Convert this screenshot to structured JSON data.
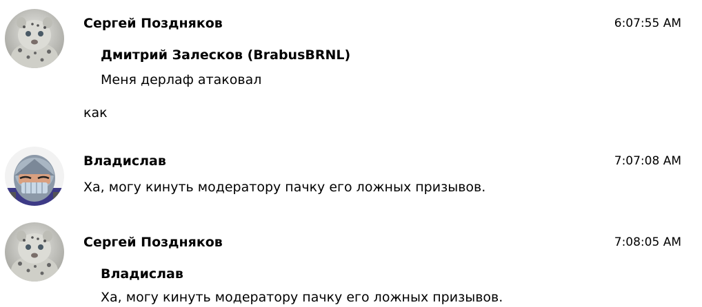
{
  "messages": [
    {
      "author": "Сергей Поздняков",
      "time": "6:07:55 AM",
      "avatar_icon": "snow-leopard-cub-avatar",
      "quote": {
        "author": "Дмитрий Залесков (BrabusBRNL)",
        "text": "Меня дерлаф атаковал"
      },
      "text": "как"
    },
    {
      "author": "Владислав",
      "time": "7:07:08 AM",
      "avatar_icon": "masked-character-avatar",
      "text": "Ха, могу кинуть модератору пачку его ложных призывов."
    },
    {
      "author": "Сергей Поздняков",
      "time": "7:08:05 AM",
      "avatar_icon": "snow-leopard-cub-avatar",
      "quote": {
        "author": "Владислав",
        "text": "Ха, могу кинуть модератору пачку его ложных призывов."
      }
    }
  ]
}
